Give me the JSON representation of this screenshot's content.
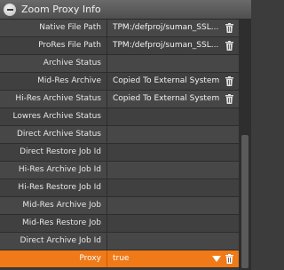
{
  "panel": {
    "title": "Zoom Proxy Info"
  },
  "rows": [
    {
      "label": "Native File Path",
      "value": "TPM:/defproj/suman_SSL...",
      "deletable": true
    },
    {
      "label": "ProRes File Path",
      "value": "TPM:/defproj/suman_SSL...",
      "deletable": true
    },
    {
      "label": "Archive Status",
      "value": "",
      "deletable": false
    },
    {
      "label": "Mid-Res Archive",
      "value": "Copied To External System",
      "deletable": true
    },
    {
      "label": "Hi-Res Archive Status",
      "value": "Copied To External System",
      "deletable": true
    },
    {
      "label": "Lowres Archive Status",
      "value": "",
      "deletable": false
    },
    {
      "label": "Direct Archive Status",
      "value": "",
      "deletable": false
    },
    {
      "label": "Direct Restore Job Id",
      "value": "",
      "deletable": false
    },
    {
      "label": "Hi-Res Archive Job Id",
      "value": "",
      "deletable": false
    },
    {
      "label": "Hi-Res Restore Job Id",
      "value": "",
      "deletable": false
    },
    {
      "label": "Mid-Res Archive Job",
      "value": "",
      "deletable": false
    },
    {
      "label": "Mid-Res Restore Job",
      "value": "",
      "deletable": false
    },
    {
      "label": "Direct Archive Job Id",
      "value": "",
      "deletable": false
    },
    {
      "label": "Proxy",
      "value": "true",
      "deletable": true,
      "selected": true
    }
  ],
  "icons": {
    "collapse": "minus-circle-icon",
    "delete": "trash-icon",
    "dropdown": "dropdown-arrow-icon"
  },
  "colors": {
    "accent": "#f07a17",
    "panel_bg": "#474747",
    "header_bg": "#5a5a5a"
  }
}
